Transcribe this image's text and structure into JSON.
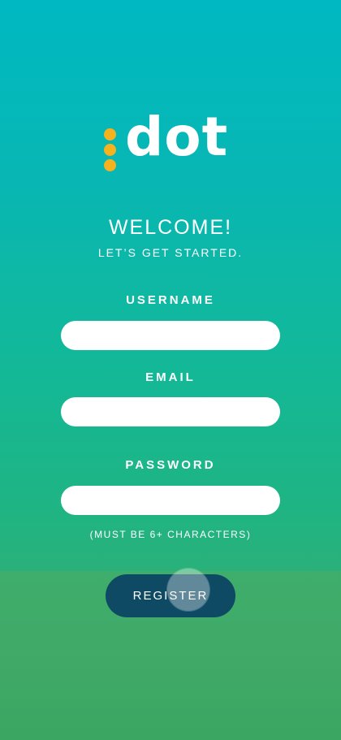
{
  "brand": {
    "logo_text": "dot",
    "dot_color": "#f4b21e"
  },
  "header": {
    "welcome": "WELCOME!",
    "subtitle": "LET’S GET STARTED."
  },
  "form": {
    "username": {
      "label": "USERNAME",
      "value": "",
      "placeholder": ""
    },
    "email": {
      "label": "EMAIL",
      "value": "",
      "placeholder": ""
    },
    "password": {
      "label": "PASSWORD",
      "value": "",
      "placeholder": ""
    },
    "password_hint": "(MUST BE 6+ CHARACTERS)",
    "register_label": "REGISTER"
  },
  "colors": {
    "gradient_top": "#00b8c2",
    "gradient_bottom": "#3aa862",
    "button_bg": "#0e4a63"
  }
}
